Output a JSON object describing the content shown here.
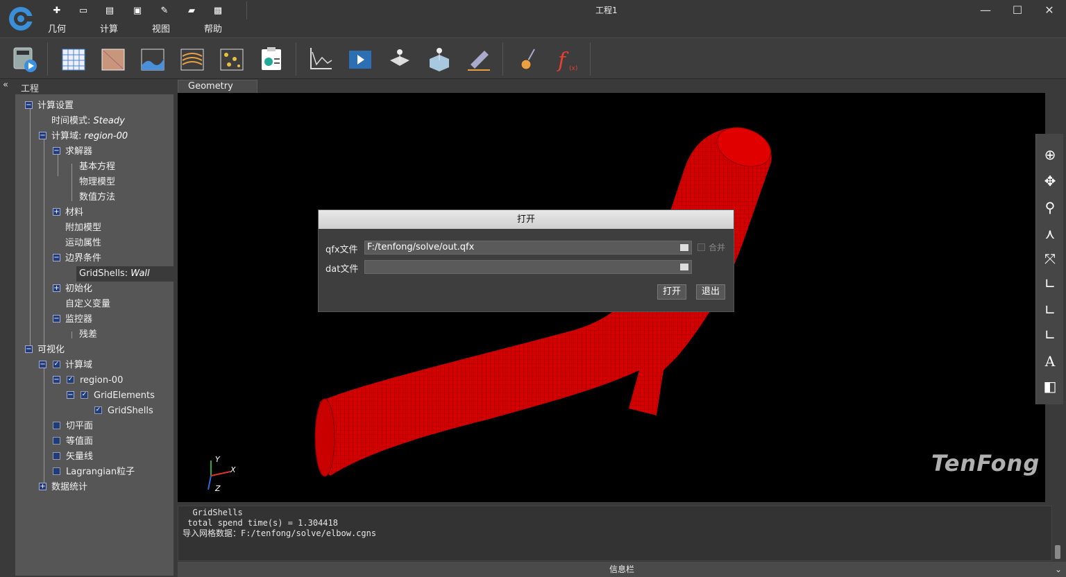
{
  "window": {
    "title": "工程1",
    "minimize": "—",
    "maximize": "☐",
    "close": "✕"
  },
  "menu": [
    "几何",
    "计算",
    "视图",
    "帮助"
  ],
  "quick_access_icons": [
    "new-file-icon",
    "open-folder-icon",
    "import-icon",
    "export-icon",
    "edit-icon",
    "save-icon",
    "save-as-icon"
  ],
  "toolbar_icons": [
    "calculator-run-icon",
    "mesh-grid-icon",
    "surface-icon",
    "contour-icon",
    "streamline-icon",
    "particles-icon",
    "report-icon",
    "residual-plot-icon",
    "animation-icon",
    "probe-point-icon",
    "probe-surface-icon",
    "ruler-icon",
    "brush-icon",
    "function-icon"
  ],
  "left_panel": {
    "collapse": "«",
    "title": "工程"
  },
  "tree": {
    "calc_settings": "计算设置",
    "time_mode_label": "时间模式:",
    "time_mode_value": "Steady",
    "domain_label": "计算域:",
    "domain_value": "region-00",
    "solver": "求解器",
    "basic_eq": "基本方程",
    "physics": "物理模型",
    "numeric": "数值方法",
    "material": "材料",
    "addon": "附加模型",
    "motion": "运动属性",
    "boundary": "边界条件",
    "gridshells_label": "GridShells:",
    "gridshells_value": "Wall",
    "init": "初始化",
    "custom_var": "自定义变量",
    "monitor": "监控器",
    "residual": "残差",
    "visualize": "可视化",
    "vis_domain": "计算域",
    "region": "region-00",
    "grid_elements": "GridElements",
    "grid_shells": "GridShells",
    "cut_plane": "切平面",
    "isosurface": "等值面",
    "vector": "矢量线",
    "lagrangian": "Lagrangian粒子",
    "stats": "数据统计"
  },
  "tabs": {
    "geometry": "Geometry"
  },
  "viewport": {
    "axis_y": "Y",
    "axis_x": "X",
    "axis_z": "Z",
    "brand": "TenFong"
  },
  "right_tools": [
    "rotate-icon",
    "pan-icon",
    "zoom-icon",
    "axes-icon",
    "fit-icon",
    "view-xy-icon",
    "view-zx-icon",
    "view-zy-icon",
    "text-icon",
    "clip-icon"
  ],
  "dialog": {
    "title": "打开",
    "qfx_label": "qfx文件",
    "qfx_value": "F:/tenfong/solve/out.qfx",
    "merge_label": "合并",
    "dat_label": "dat文件",
    "dat_value": "",
    "open_button": "打开",
    "exit_button": "退出"
  },
  "log": {
    "line1": "  GridShells",
    "line2": "",
    "line3": " total spend time(s) = 1.304418",
    "line4": "导入网格数据：F:/tenfong/solve/elbow.cgns"
  },
  "status": {
    "label": "信息栏"
  }
}
